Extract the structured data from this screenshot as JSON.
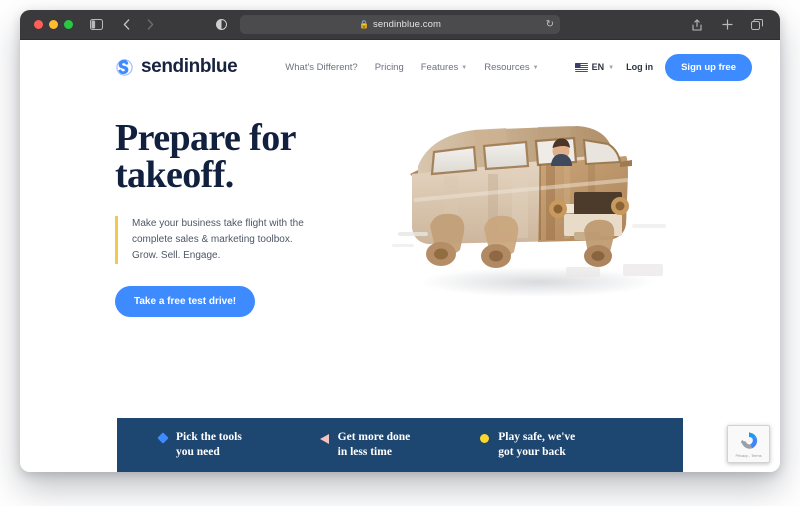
{
  "browser": {
    "traffic_lights": [
      "close",
      "minimize",
      "maximize"
    ],
    "sidebar_icon": "sidebar-icon",
    "back_icon": "chevron-left-icon",
    "forward_icon": "chevron-right-icon",
    "reader_icon": "reader-mode-icon",
    "url": "sendinblue.com",
    "lock_icon": "lock-icon",
    "reload_icon": "reload-icon",
    "share_icon": "share-icon",
    "new_tab_icon": "plus-icon",
    "tabs_overview_icon": "tabs-overview-icon"
  },
  "site": {
    "logo_text": "sendinblue",
    "nav": [
      {
        "label": "What's Different?",
        "has_caret": false
      },
      {
        "label": "Pricing",
        "has_caret": false
      },
      {
        "label": "Features",
        "has_caret": true
      },
      {
        "label": "Resources",
        "has_caret": true
      }
    ],
    "language": "EN",
    "login_label": "Log in",
    "signup_label": "Sign up free"
  },
  "hero": {
    "title_line1": "Prepare for",
    "title_line2": "takeoff.",
    "subtitle_line1": "Make your business take flight with the",
    "subtitle_line2": "complete sales & marketing toolbox.",
    "subtitle_line3": "Grow. Sell. Engage.",
    "cta_label": "Take a free test drive!",
    "illustration": "wooden-lego-van-with-driver"
  },
  "features": [
    {
      "icon": "diamond-icon",
      "icon_color": "#3e8bff",
      "text": "Pick the tools\nyou need"
    },
    {
      "icon": "triangle-icon",
      "icon_color": "#f4c4c0",
      "text": "Get more done\nin less time"
    },
    {
      "icon": "circle-icon",
      "icon_color": "#fcd72b",
      "text": "Play safe, we've\ngot your back"
    }
  ],
  "recaptcha": {
    "icon": "recaptcha-icon",
    "label": "Privacy - Terms"
  },
  "colors": {
    "brand_blue": "#3e8bff",
    "navy": "#11203f",
    "band_navy": "#1d4670",
    "accent_yellow": "#f2c94c",
    "chrome_dark": "#3a3a3c"
  }
}
